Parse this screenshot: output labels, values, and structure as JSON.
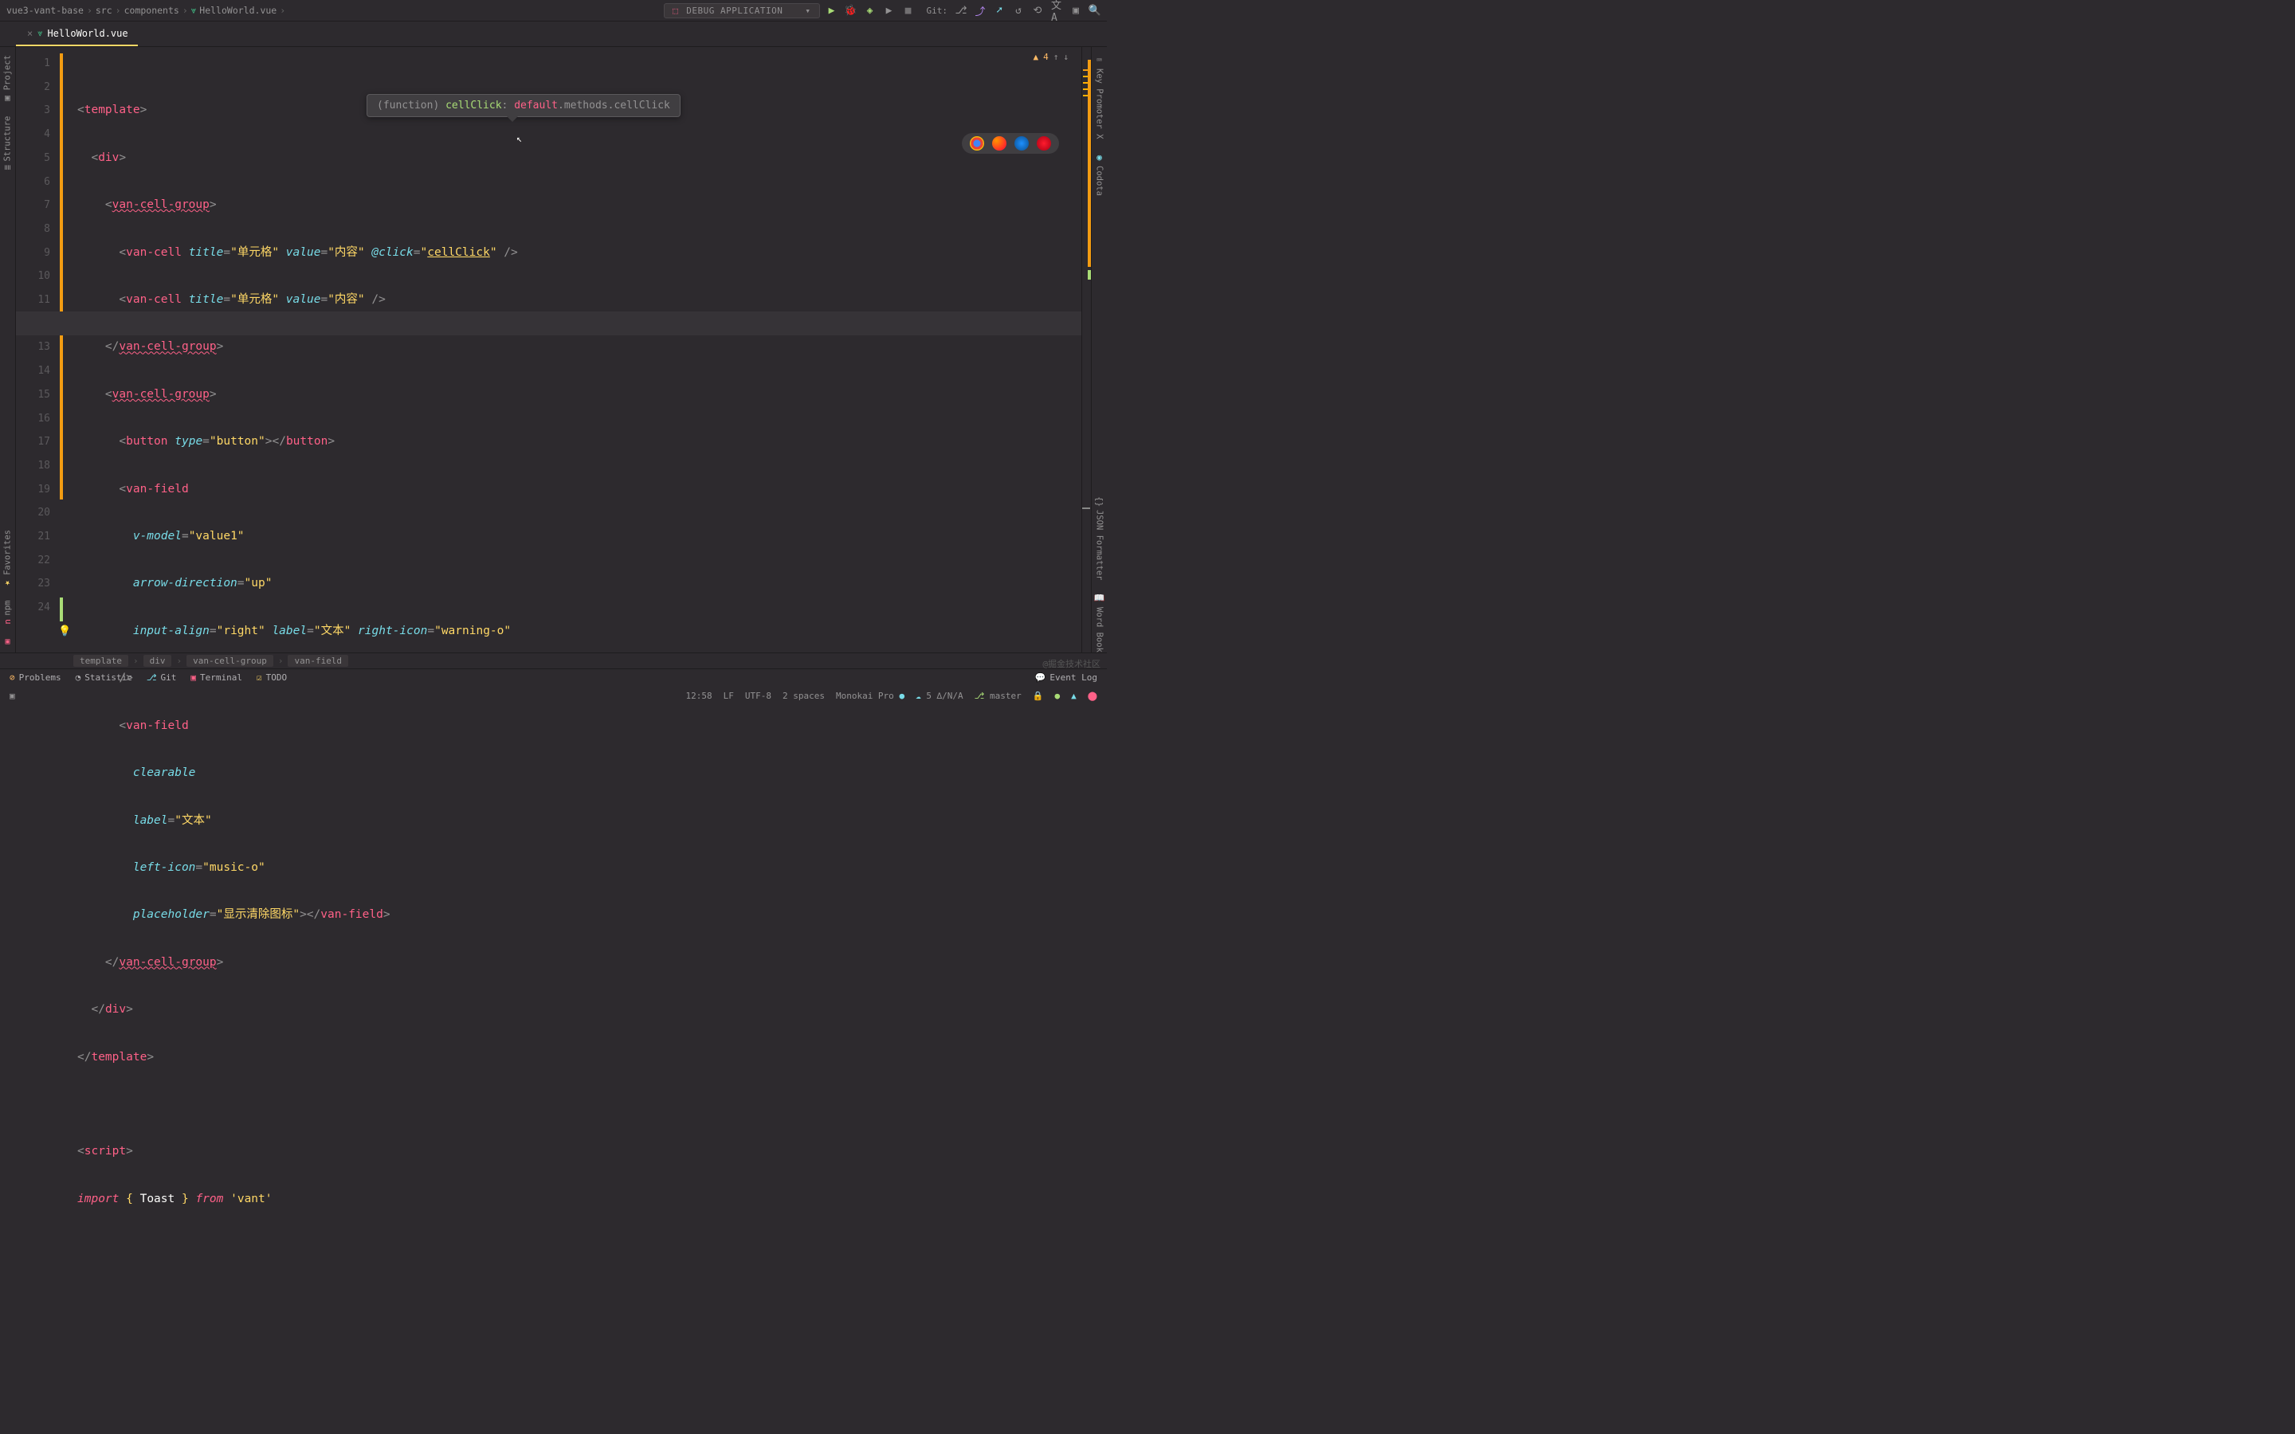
{
  "breadcrumb": {
    "project": "vue3-vant-base",
    "dir1": "src",
    "dir2": "components",
    "file": "HelloWorld.vue"
  },
  "tab": {
    "filename": "HelloWorld.vue"
  },
  "topbar": {
    "debug": "DEBUG APPLICATION",
    "git": "Git:"
  },
  "left_tools": {
    "project": "Project",
    "structure": "Structure",
    "favorites": "Favorites",
    "npm": "npm"
  },
  "right_tools": {
    "keypromoter": "Key Promoter X",
    "codota": "Codota",
    "json": "JSON Formatter",
    "wordbook": "Word Book"
  },
  "inspections": {
    "warn_count": "4"
  },
  "tooltip": {
    "pre": "(function) ",
    "fn": "cellClick",
    "colon": ": ",
    "def": "default",
    "rest": ".methods.cellClick"
  },
  "lines": {
    "l1_template": "template",
    "l2_div": "div",
    "l3_vcg": "van-cell-group",
    "l4": {
      "tag": "van-cell",
      "a1": "title",
      "v1": "\"单元格\"",
      "a2": "value",
      "v2": "\"内容\"",
      "a3": "@click",
      "v3": "cellClick"
    },
    "l5": {
      "tag": "van-cell",
      "a1": "title",
      "v1": "\"单元格\"",
      "a2": "value",
      "v2": "\"内容\""
    },
    "l6_vcg": "van-cell-group",
    "l7_vcg": "van-cell-group",
    "l8": {
      "tag": "button",
      "a": "type",
      "v": "\"button\""
    },
    "l9_vf": "van-field",
    "l10": {
      "a": "v-model",
      "v": "\"value1\""
    },
    "l11": {
      "a": "arrow-direction",
      "v": "\"up\""
    },
    "l12": {
      "a1": "input-align",
      "v1": "\"right\"",
      "a2": "label",
      "v2": "\"文本\"",
      "a3": "right-icon",
      "v3": "\"warning-o\""
    },
    "l14_vf": "van-field",
    "l15_clr": "clearable",
    "l16": {
      "a": "label",
      "v": "\"文本\""
    },
    "l17": {
      "a": "left-icon",
      "v": "\"music-o\""
    },
    "l18": {
      "a": "placeholder",
      "v": "\"显示清除图标\"",
      "close": "van-field"
    },
    "l19_vcg": "van-cell-group",
    "l20_div": "div",
    "l21_template": "template",
    "l23_script": "script",
    "l24": {
      "import": "import",
      "toast": "Toast",
      "from": "from",
      "mod": "'vant'"
    }
  },
  "bot_breadcrumb": {
    "b1": "template",
    "b2": "div",
    "b3": "van-cell-group",
    "b4": "van-field"
  },
  "bottom": {
    "problems": "Problems",
    "statistic": "Statistic",
    "git": "Git",
    "terminal": "Terminal",
    "todo": "TODO",
    "eventlog": "Event Log"
  },
  "status": {
    "pos": "12:58",
    "lf": "LF",
    "enc": "UTF-8",
    "indent": "2 spaces",
    "theme": "Monokai Pro",
    "cov": "5 ∆/N/A",
    "branch": "master"
  },
  "watermark": "@掘金技术社区"
}
